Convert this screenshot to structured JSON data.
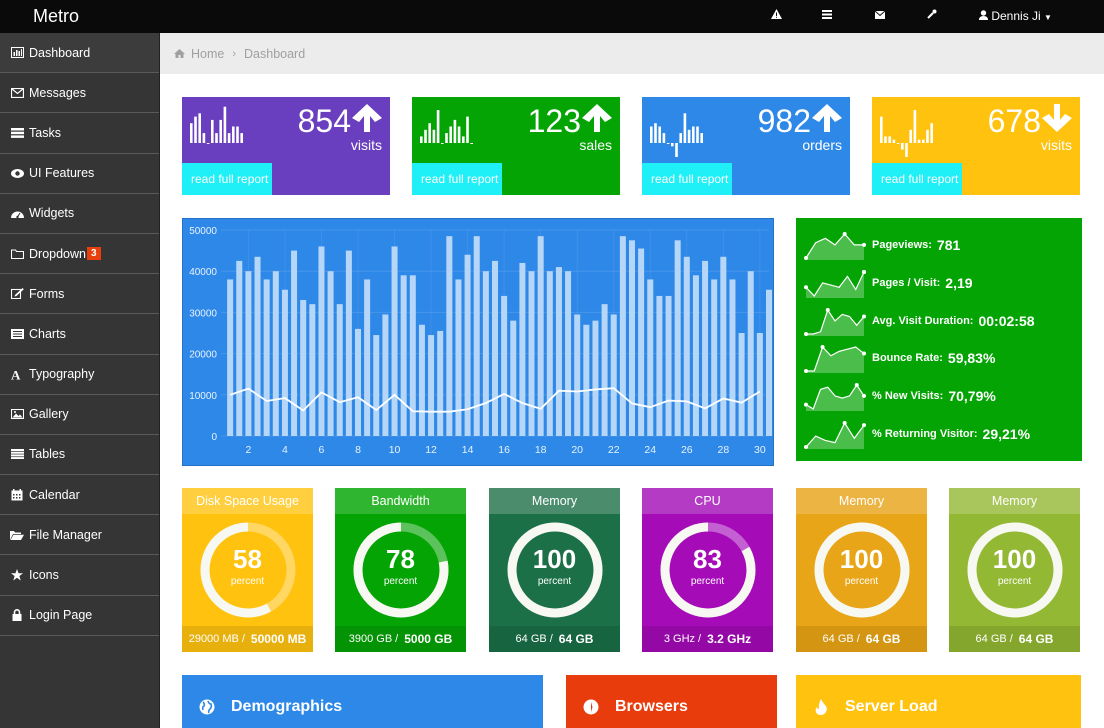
{
  "topbar": {
    "brand": "Metro",
    "icons": [
      "warning-icon",
      "tasks-icon",
      "envelope-icon",
      "wrench-icon"
    ],
    "user_name": "Dennis Ji"
  },
  "sidebar": {
    "items": [
      {
        "label": "Dashboard",
        "icon": "bar-chart-icon"
      },
      {
        "label": "Messages",
        "icon": "envelope-icon"
      },
      {
        "label": "Tasks",
        "icon": "tasks-icon"
      },
      {
        "label": "UI Features",
        "icon": "eye-icon"
      },
      {
        "label": "Widgets",
        "icon": "dashboard-icon"
      },
      {
        "label": "Dropdown",
        "icon": "folder-icon",
        "badge": "3"
      },
      {
        "label": "Forms",
        "icon": "edit-icon"
      },
      {
        "label": "Charts",
        "icon": "list-alt-icon"
      },
      {
        "label": "Typography",
        "icon": "font-icon"
      },
      {
        "label": "Gallery",
        "icon": "picture-icon"
      },
      {
        "label": "Tables",
        "icon": "table-icon"
      },
      {
        "label": "Calendar",
        "icon": "calendar-icon"
      },
      {
        "label": "File Manager",
        "icon": "folder-open-icon"
      },
      {
        "label": "Icons",
        "icon": "star-icon"
      },
      {
        "label": "Login Page",
        "icon": "lock-icon"
      }
    ]
  },
  "breadcrumb": {
    "home": "Home",
    "current": "Dashboard"
  },
  "stats": [
    {
      "value": "854",
      "label": "visits",
      "trend": "up",
      "link": "read full report",
      "color": "#6a3fbf",
      "spark": [
        6,
        8,
        9,
        3,
        0,
        7,
        3,
        7,
        11,
        3,
        5,
        5,
        3
      ]
    },
    {
      "value": "123",
      "label": "sales",
      "trend": "up",
      "link": "read full report",
      "color": "#05a405",
      "spark": [
        2,
        4,
        6,
        4,
        10,
        0,
        3,
        5,
        7,
        5,
        2,
        8,
        0
      ]
    },
    {
      "value": "982",
      "label": "orders",
      "trend": "up",
      "link": "read full report",
      "color": "#2e88e8",
      "spark": [
        5,
        6,
        5,
        3,
        0,
        -1,
        -5,
        3,
        9,
        4,
        5,
        5,
        3
      ]
    },
    {
      "value": "678",
      "label": "visits",
      "trend": "down",
      "link": "read full report",
      "color": "#ffc20e",
      "spark": [
        8,
        2,
        2,
        1,
        0,
        -2,
        -6,
        4,
        10,
        1,
        1,
        4,
        6
      ]
    }
  ],
  "chart_data": {
    "type": "bar",
    "title": "",
    "xlabel": "",
    "ylabel": "",
    "x_ticks": [
      2,
      4,
      6,
      8,
      10,
      12,
      14,
      16,
      18,
      20,
      22,
      24,
      26,
      28,
      30
    ],
    "y_ticks": [
      0,
      10000,
      20000,
      30000,
      40000,
      50000
    ],
    "ylim": [
      0,
      50000
    ],
    "xlim": [
      0.5,
      30.5
    ],
    "grid": true,
    "series": [
      {
        "name": "bars",
        "type": "bar",
        "x": [
          1,
          1.5,
          2,
          2.5,
          3,
          3.5,
          4,
          4.5,
          5,
          5.5,
          6,
          6.5,
          7,
          7.5,
          8,
          8.5,
          9,
          9.5,
          10,
          10.5,
          11,
          11.5,
          12,
          12.5,
          13,
          13.5,
          14,
          14.5,
          15,
          15.5,
          16,
          16.5,
          17,
          17.5,
          18,
          18.5,
          19,
          19.5,
          20,
          20.5,
          21,
          21.5,
          22,
          22.5,
          23,
          23.5,
          24,
          24.5,
          25,
          25.5,
          26,
          26.5,
          27,
          27.5,
          28,
          28.5,
          29,
          29.5,
          30,
          30.5
        ],
        "values": [
          38000,
          42500,
          40000,
          43500,
          38000,
          40000,
          35500,
          45000,
          33000,
          32000,
          46000,
          40000,
          32000,
          45000,
          26000,
          38000,
          24500,
          29500,
          46000,
          39000,
          39000,
          27000,
          24500,
          25500,
          48500,
          38000,
          44000,
          48500,
          40000,
          42500,
          34000,
          28000,
          42000,
          40000,
          48500,
          40000,
          41000,
          40000,
          29500,
          27000,
          28000,
          32000,
          29500,
          48500,
          47500,
          45500,
          38000,
          34000,
          34000,
          47500,
          43500,
          39000,
          42500,
          38000,
          43500,
          38000,
          25000,
          40000,
          25000,
          35500
        ]
      },
      {
        "name": "line",
        "type": "line",
        "x": [
          1,
          2,
          3,
          4,
          5,
          6,
          7,
          8,
          9,
          10,
          11,
          12,
          13,
          14,
          15,
          16,
          17,
          18,
          19,
          20,
          21,
          22,
          23,
          24,
          25,
          26,
          27,
          28,
          29,
          30
        ],
        "values": [
          10000,
          11500,
          8500,
          9200,
          6200,
          10600,
          8200,
          9400,
          6300,
          10000,
          6000,
          5900,
          5900,
          6500,
          8000,
          10200,
          8000,
          6600,
          11000,
          10800,
          11300,
          11600,
          7900,
          7000,
          8600,
          8400,
          6700,
          9100,
          8100,
          10800
        ]
      }
    ]
  },
  "metrics": [
    {
      "label": "Pageviews:",
      "value": "781",
      "spark": [
        0,
        7,
        9,
        6,
        11,
        6,
        6
      ]
    },
    {
      "label": "Pages / Visit:",
      "value": "2,19",
      "spark": [
        4,
        0,
        6,
        5,
        4,
        9,
        3,
        11
      ]
    },
    {
      "label": "Avg. Visit Duration:",
      "value": "00:02:58",
      "spark": [
        0,
        0,
        1,
        11,
        6,
        9,
        8,
        4,
        8
      ]
    },
    {
      "label": "Bounce Rate:",
      "value": "59,83%",
      "spark": [
        0,
        0,
        11,
        7,
        9,
        10,
        11,
        8
      ]
    },
    {
      "label": "% New Visits:",
      "value": "70,79%",
      "spark": [
        2,
        0,
        9,
        10,
        6,
        5,
        6,
        11,
        6
      ]
    },
    {
      "label": "% Returning Visitor:",
      "value": "29,21%",
      "spark": [
        0,
        5,
        3,
        2,
        11,
        4,
        10
      ]
    }
  ],
  "gauges": [
    {
      "title": "Disk Space Usage",
      "value": "58",
      "percent": 58,
      "unit": "percent",
      "used": "29000 MB",
      "total": "50000 MB",
      "color": "#ffc20e",
      "header": "#ffcf40",
      "footer": "#e8b00c"
    },
    {
      "title": "Bandwidth",
      "value": "78",
      "percent": 78,
      "unit": "percent",
      "used": "3900 GB",
      "total": "5000 GB",
      "color": "#05a405",
      "header": "#2fb52f",
      "footer": "#049304"
    },
    {
      "title": "Memory",
      "value": "100",
      "percent": 100,
      "unit": "percent",
      "used": "64 GB",
      "total": "64 GB",
      "color": "#1c7048",
      "header": "#4a8c6c",
      "footer": "#176440"
    },
    {
      "title": "CPU",
      "value": "83",
      "percent": 83,
      "unit": "percent",
      "used": "3 GHz",
      "total": "3.2 GHz",
      "color": "#a50cb8",
      "header": "#b43cc4",
      "footer": "#9409a6"
    },
    {
      "title": "Memory",
      "value": "100",
      "percent": 100,
      "unit": "percent",
      "used": "64 GB",
      "total": "64 GB",
      "color": "#e8a517",
      "header": "#ecb442",
      "footer": "#d49512"
    },
    {
      "title": "Memory",
      "value": "100",
      "percent": 100,
      "unit": "percent",
      "used": "64 GB",
      "total": "64 GB",
      "color": "#93b834",
      "header": "#a8c65c",
      "footer": "#84a62d"
    }
  ],
  "panels": [
    {
      "title": "Demographics",
      "icon": "globe-icon",
      "color": "#2e88e8"
    },
    {
      "title": "Browsers",
      "icon": "compass-icon",
      "color": "#e83c0c"
    },
    {
      "title": "Server Load",
      "icon": "fire-icon",
      "color": "#ffc20e"
    }
  ]
}
